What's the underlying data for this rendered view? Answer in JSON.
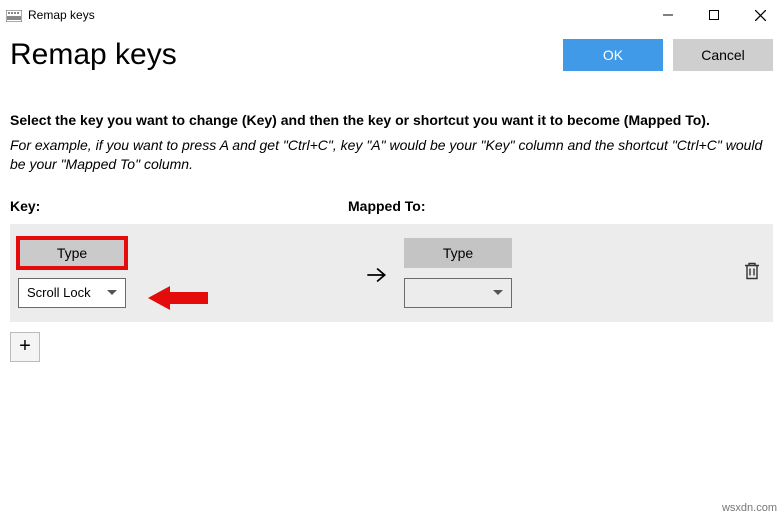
{
  "window": {
    "title": "Remap keys"
  },
  "header": {
    "title": "Remap keys",
    "ok_label": "OK",
    "cancel_label": "Cancel"
  },
  "instruction": "Select the key you want to change (Key) and then the key or shortcut you want it to become (Mapped To).",
  "example": "For example, if you want to press A and get \"Ctrl+C\", key \"A\" would be your \"Key\" column and the shortcut \"Ctrl+C\" would be your \"Mapped To\" column.",
  "columns": {
    "key": "Key:",
    "mapped": "Mapped To:"
  },
  "row": {
    "key_type_label": "Type",
    "key_select_value": "Scroll Lock",
    "mapped_type_label": "Type",
    "mapped_select_value": ""
  },
  "add_label": "+",
  "watermark": "wsxdn.com"
}
